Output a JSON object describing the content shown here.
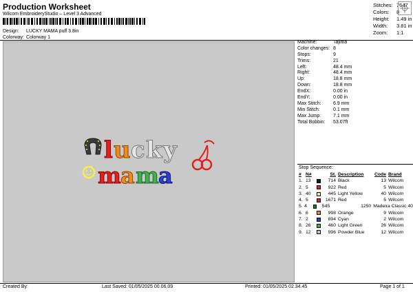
{
  "title": "Production Worksheet",
  "software": "Wilcom EmbroideryStudio – Level 3 Advanced",
  "design": {
    "label": "Design:",
    "value": "LUCKY MAMA puff 3.8in"
  },
  "colorway": {
    "label": "Colorway:",
    "value": "Colorway 1"
  },
  "stats": [
    {
      "label": "Stitches:",
      "value": "7647"
    },
    {
      "label": "Colors:",
      "value": "8"
    },
    {
      "label": "Height:",
      "value": "1.49 in"
    },
    {
      "label": "Width:",
      "value": "3.81 in"
    },
    {
      "label": "Zoom:",
      "value": "1:1"
    }
  ],
  "machine": [
    {
      "label": "Machine:",
      "value": "Tajima"
    },
    {
      "label": "Color changes:",
      "value": "8"
    },
    {
      "label": "Stops:",
      "value": "9"
    },
    {
      "label": "Trims:",
      "value": "21"
    },
    {
      "label": "Left:",
      "value": "48.4 mm"
    },
    {
      "label": "Right:",
      "value": "48.4 mm"
    },
    {
      "label": "Up:",
      "value": "18.8 mm"
    },
    {
      "label": "Down:",
      "value": "18.8 mm"
    },
    {
      "label": "EndX:",
      "value": "0.00 in"
    },
    {
      "label": "EndY:",
      "value": "0.00 in"
    },
    {
      "label": "Max Stitch:",
      "value": "6.9 mm"
    },
    {
      "label": "Min Stitch:",
      "value": "0.1 mm"
    },
    {
      "label": "Max Jump:",
      "value": "7.1 mm"
    },
    {
      "label": "Total Bobbin:",
      "value": "53.07ft"
    }
  ],
  "stop_sequence": {
    "title": "Stop Sequence:",
    "headers": [
      "#",
      "N#",
      "St.",
      "Description",
      "Code",
      "Brand"
    ],
    "rows": [
      {
        "n": "1.",
        "needle": "13",
        "color": "#1a1a1a",
        "st": "714",
        "desc": "Black",
        "code": "13",
        "brand": "Wilcom"
      },
      {
        "n": "2.",
        "needle": "5",
        "color": "#e02020",
        "st": "922",
        "desc": "Red",
        "code": "5",
        "brand": "Wilcom"
      },
      {
        "n": "3.",
        "needle": "40",
        "color": "#f4f04a",
        "st": "445",
        "desc": "Light Yellow",
        "code": "40",
        "brand": "Wilcom"
      },
      {
        "n": "4.",
        "needle": "5",
        "color": "#e02020",
        "st": "1671",
        "desc": "Red",
        "code": "5",
        "brand": "Wilcom"
      },
      {
        "n": "5.",
        "needle": "4",
        "color": "#1f7a2e",
        "st": "545",
        "desc": "",
        "code": "1250",
        "brand": "Madeira Classic 40"
      },
      {
        "n": "6.",
        "needle": "6",
        "color": "#f08a1a",
        "st": "998",
        "desc": "Orange",
        "code": "9",
        "brand": "Wilcom"
      },
      {
        "n": "7.",
        "needle": "2",
        "color": "#2b3fd0",
        "st": "894",
        "desc": "Cyan",
        "code": "2",
        "brand": "Wilcom"
      },
      {
        "n": "8.",
        "needle": "26",
        "color": "#3fb04a",
        "st": "460",
        "desc": "Light Green",
        "code": "26",
        "brand": "Wilcom"
      },
      {
        "n": "9.",
        "needle": "12",
        "color": "#b9c4d6",
        "st": "996",
        "desc": "Powder Blue",
        "code": "12",
        "brand": "Wilcom"
      }
    ]
  },
  "footer": {
    "created": "Created By:",
    "saved": "Last Saved: 01/05/2025 00.06.09",
    "printed": "Printed: 01/05/2025 02.34.45",
    "page": "Page 1 of 1"
  }
}
